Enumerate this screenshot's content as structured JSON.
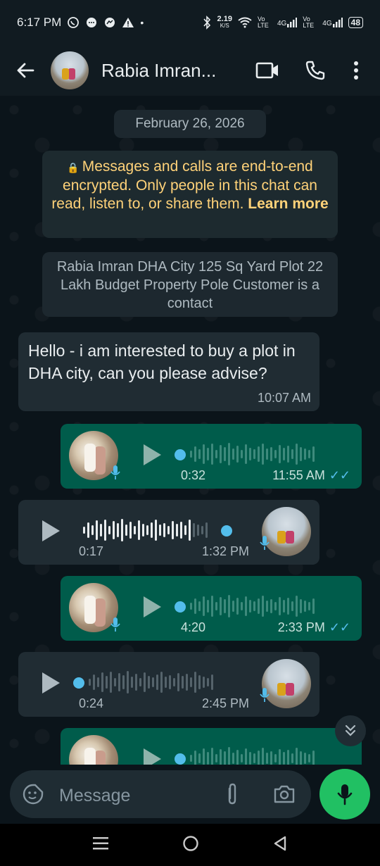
{
  "status_bar": {
    "time": "6:17 PM",
    "speed_value": "2.19",
    "speed_unit": "K/S",
    "net_1": "Vo LTE",
    "signal_1": "4G",
    "net_2": "Vo LTE",
    "signal_2": "4G",
    "battery": "48"
  },
  "header": {
    "contact_name": "Rabia Imran..."
  },
  "chat": {
    "date": "February 26, 2026",
    "encryption_text": "Messages and calls are end-to-end encrypted. Only people in this chat can read, listen to, or share them.",
    "encryption_link": "Learn more",
    "contact_note": "Rabia Imran DHA City 125 Sq Yard Plot 22 Lakh Budget Property Pole Customer is a contact",
    "messages": [
      {
        "type": "text",
        "direction": "in",
        "text": "Hello - i am interested to buy a plot in DHA city, can you please advise?",
        "time": "10:07 AM"
      },
      {
        "type": "voice",
        "direction": "out",
        "duration": "0:32",
        "time": "11:55 AM",
        "progress": 0
      },
      {
        "type": "voice",
        "direction": "in",
        "duration": "0:17",
        "time": "1:32 PM",
        "progress": 0.88
      },
      {
        "type": "voice",
        "direction": "out",
        "duration": "4:20",
        "time": "2:33 PM",
        "progress": 0
      },
      {
        "type": "voice",
        "direction": "in",
        "duration": "0:24",
        "time": "2:45 PM",
        "progress": 0
      },
      {
        "type": "voice",
        "direction": "out",
        "duration": "",
        "time": "",
        "progress": 0
      }
    ]
  },
  "composer": {
    "placeholder": "Message"
  },
  "colors": {
    "outgoing_bubble": "#005c4b",
    "incoming_bubble": "#202c33",
    "accent_green": "#21c063",
    "tick_blue": "#53bdeb",
    "encryption_text": "#ffd279"
  }
}
